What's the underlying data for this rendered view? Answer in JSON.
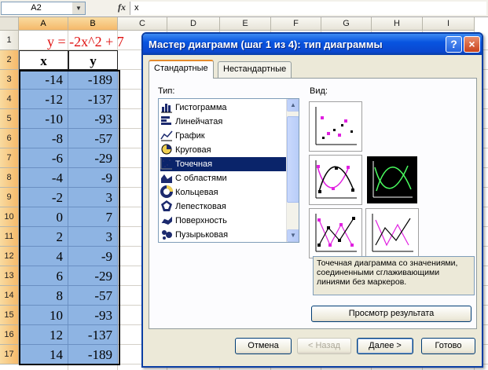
{
  "formula_bar": {
    "name_box": "A2",
    "fx_label": "fx",
    "formula": "x"
  },
  "sheet": {
    "columns": [
      "A",
      "B",
      "C",
      "D",
      "E",
      "F",
      "G",
      "H",
      "I"
    ],
    "rows": [
      "1",
      "2",
      "3",
      "4",
      "5",
      "6",
      "7",
      "8",
      "9",
      "10",
      "11",
      "12",
      "13",
      "14",
      "15",
      "16",
      "17"
    ],
    "title": "y = -2x^2 + 7",
    "headers": [
      "x",
      "y"
    ],
    "data": [
      [
        "-14",
        "-189"
      ],
      [
        "-12",
        "-137"
      ],
      [
        "-10",
        "-93"
      ],
      [
        "-8",
        "-57"
      ],
      [
        "-6",
        "-29"
      ],
      [
        "-4",
        "-9"
      ],
      [
        "-2",
        "3"
      ],
      [
        "0",
        "7"
      ],
      [
        "2",
        "3"
      ],
      [
        "4",
        "-9"
      ],
      [
        "6",
        "-29"
      ],
      [
        "8",
        "-57"
      ],
      [
        "10",
        "-93"
      ],
      [
        "12",
        "-137"
      ],
      [
        "14",
        "-189"
      ]
    ]
  },
  "dialog": {
    "title": "Мастер диаграмм (шаг 1 из 4): тип диаграммы",
    "help_label": "?",
    "close_label": "×",
    "tabs": [
      "Стандартные",
      "Нестандартные"
    ],
    "type_label": "Тип:",
    "view_label": "Вид:",
    "chart_types": [
      {
        "label": "Гистограмма",
        "icon": "column-chart-icon"
      },
      {
        "label": "Линейчатая",
        "icon": "bar-chart-icon"
      },
      {
        "label": "График",
        "icon": "line-chart-icon"
      },
      {
        "label": "Круговая",
        "icon": "pie-chart-icon"
      },
      {
        "label": "Точечная",
        "icon": "scatter-chart-icon"
      },
      {
        "label": "С областями",
        "icon": "area-chart-icon"
      },
      {
        "label": "Кольцевая",
        "icon": "doughnut-chart-icon"
      },
      {
        "label": "Лепестковая",
        "icon": "radar-chart-icon"
      },
      {
        "label": "Поверхность",
        "icon": "surface-chart-icon"
      },
      {
        "label": "Пузырьковая",
        "icon": "bubble-chart-icon"
      }
    ],
    "selected_type": "Точечная",
    "subtypes": [
      "scatter-markers",
      "smooth-lines-markers",
      "smooth-lines",
      "straight-lines-markers",
      "straight-lines"
    ],
    "selected_subtype": "smooth-lines",
    "description": "Точечная диаграмма со значениями, соединенными сглаживающими линиями без маркеров.",
    "preview_button": "Просмотр результата",
    "buttons": {
      "cancel": "Отмена",
      "back": "< Назад",
      "next": "Далее >",
      "finish": "Готово"
    },
    "colors": {
      "title_bar": "#0a47cf",
      "selection": "#0a246a",
      "cell_selection": "#8eb4e3",
      "title_text": "#e0100f"
    }
  }
}
